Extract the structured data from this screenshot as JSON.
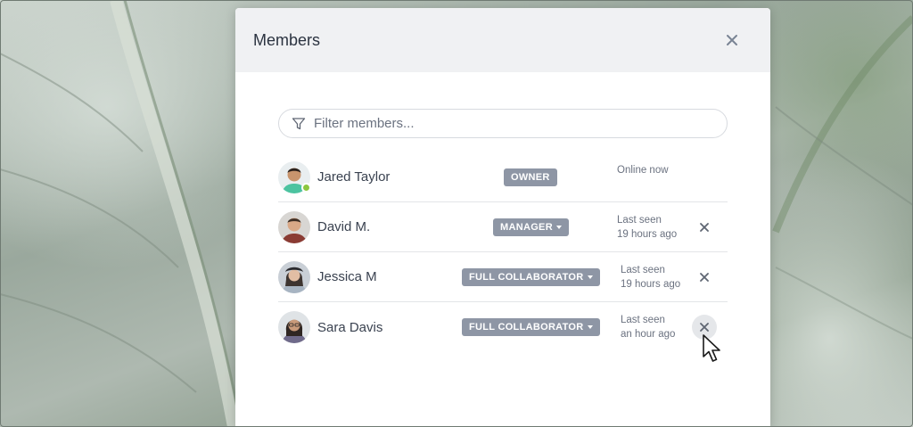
{
  "modal": {
    "title": "Members",
    "close_icon": "close-icon"
  },
  "search": {
    "placeholder": "Filter members...",
    "value": "",
    "icon": "filter-icon"
  },
  "members": [
    {
      "name": "Jared Taylor",
      "role": "OWNER",
      "has_dropdown": false,
      "status_line1": "Online now",
      "status_line2": "",
      "online": true,
      "removable": false
    },
    {
      "name": "David M.",
      "role": "MANAGER",
      "has_dropdown": true,
      "status_line1": "Last seen",
      "status_line2": "19 hours ago",
      "online": false,
      "removable": true
    },
    {
      "name": "Jessica M",
      "role": "FULL COLLABORATOR",
      "has_dropdown": true,
      "status_line1": "Last seen",
      "status_line2": "19 hours ago",
      "online": false,
      "removable": true
    },
    {
      "name": "Sara Davis",
      "role": "FULL COLLABORATOR",
      "has_dropdown": true,
      "status_line1": "Last seen",
      "status_line2": "an hour ago",
      "online": false,
      "removable": true,
      "hovered": true
    }
  ],
  "colors": {
    "header_bg": "#f0f1f3",
    "role_badge": "#8e96a5",
    "online": "#8cc63f",
    "text": "#3a4250"
  }
}
